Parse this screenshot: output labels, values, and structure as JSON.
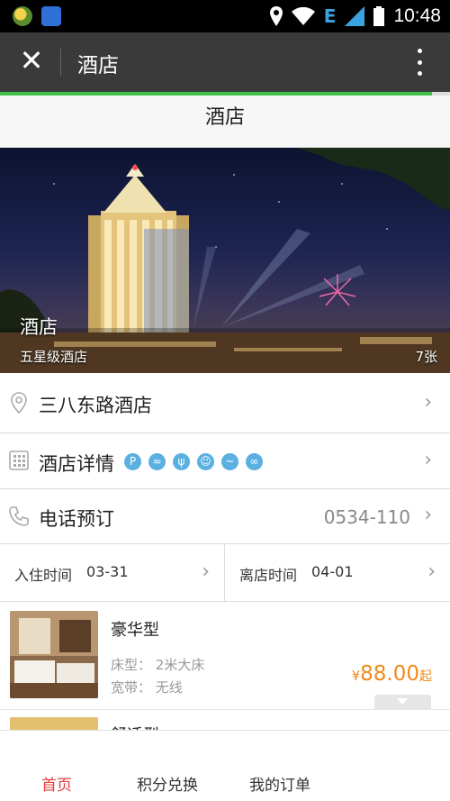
{
  "status_bar": {
    "time": "10:48",
    "network": "E",
    "icons": [
      "app-badge-icon",
      "baidu-icon",
      "location-icon",
      "wifi-icon",
      "signal-icon",
      "battery-icon"
    ]
  },
  "app_bar": {
    "title": "酒店",
    "close_icon": "close-icon",
    "more_icon": "more-vertical-icon",
    "load_progress": 0.96
  },
  "page": {
    "title": "酒店"
  },
  "hero": {
    "name": "酒店",
    "star": "五星级酒店",
    "photo_count": "7张"
  },
  "rows": {
    "address": {
      "label": "三八东路酒店",
      "icon": "location-pin-icon"
    },
    "details": {
      "label": "酒店详情",
      "icon": "building-icon",
      "facilities": [
        {
          "icon": "parking-icon",
          "glyph": "P"
        },
        {
          "icon": "wifi-icon",
          "glyph": "≈"
        },
        {
          "icon": "restaurant-icon",
          "glyph": "ψ"
        },
        {
          "icon": "meeting-icon",
          "glyph": "☺"
        },
        {
          "icon": "pool-icon",
          "glyph": "~"
        },
        {
          "icon": "gym-icon",
          "glyph": "∞"
        }
      ]
    },
    "phone": {
      "label": "电话预订",
      "value": "0534-110",
      "icon": "phone-icon"
    }
  },
  "dates": {
    "checkin_label": "入住时间",
    "checkin_value": "03-31",
    "checkout_label": "离店时间",
    "checkout_value": "04-01"
  },
  "rooms": [
    {
      "name": "豪华型",
      "bed_label": "床型：",
      "bed": "2米大床",
      "wifi_label": "宽带：",
      "wifi": "无线",
      "currency": "¥",
      "price": "88.00",
      "price_suffix": "起"
    },
    {
      "name": "舒适型"
    }
  ],
  "tabs": [
    {
      "label": "首页",
      "active": true
    },
    {
      "label": "积分兑换",
      "active": false
    },
    {
      "label": "我的订单",
      "active": false
    }
  ],
  "colors": {
    "accent_price": "#f08a1c",
    "tab_active": "#e23c3c",
    "progress": "#44c14a",
    "facility_icon": "#5ab0e0"
  }
}
